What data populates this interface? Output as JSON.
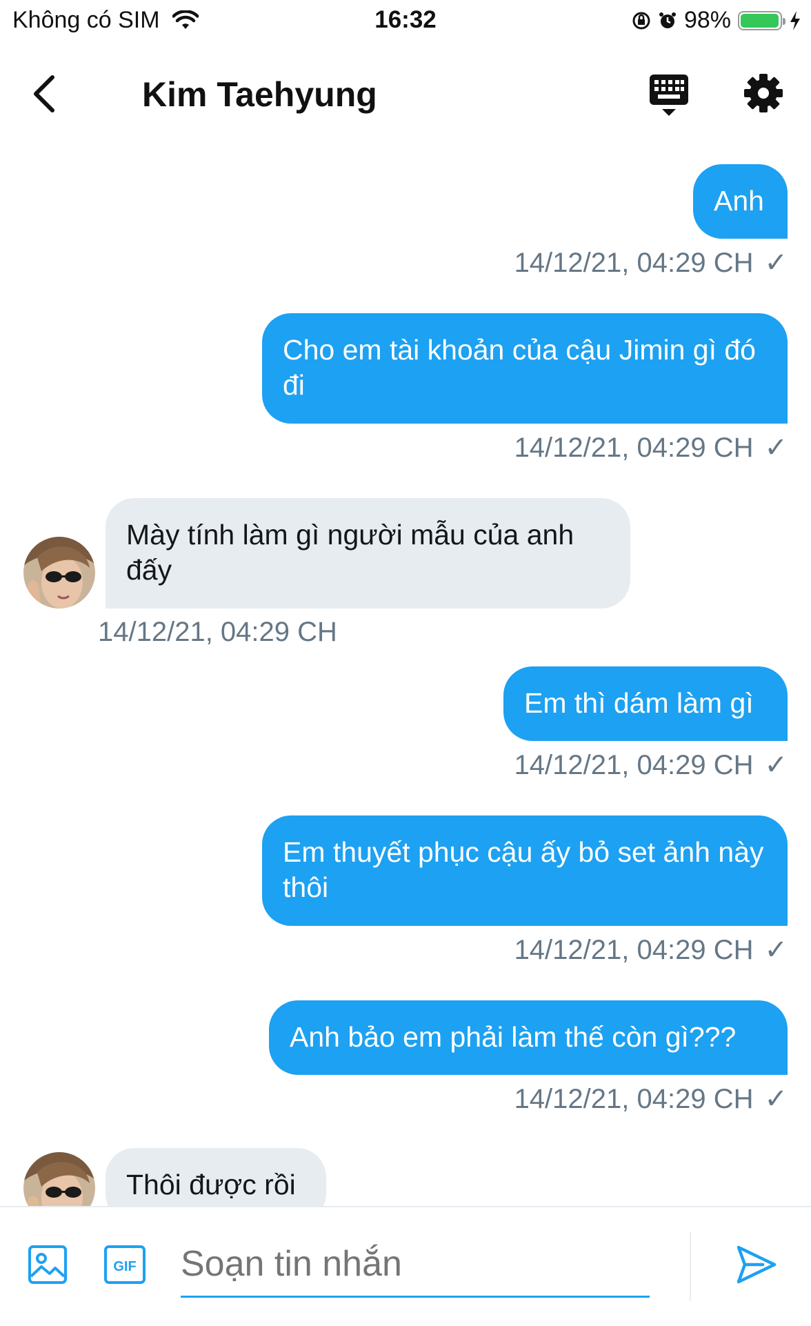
{
  "status_bar": {
    "carrier": "Không có SIM",
    "time": "16:32",
    "battery": "98%",
    "battery_level": 0.98
  },
  "header": {
    "title": "Kim Taehyung"
  },
  "messages": [
    {
      "direction": "out",
      "text": "Anh",
      "time": "14/12/21, 04:29 CH",
      "check": "✓"
    },
    {
      "direction": "out",
      "text": "Cho em tài khoản của cậu Jimin gì đó đi",
      "time": "14/12/21, 04:29 CH",
      "check": "✓"
    },
    {
      "direction": "in",
      "text": "Mày tính làm gì người mẫu của anh đấy",
      "time": "14/12/21, 04:29 CH"
    },
    {
      "direction": "out",
      "text": "Em thì dám làm gì",
      "time": "14/12/21, 04:29 CH",
      "check": "✓"
    },
    {
      "direction": "out",
      "text": "Em thuyết phục cậu ấy bỏ set ảnh này thôi",
      "time": "14/12/21, 04:29 CH",
      "check": "✓"
    },
    {
      "direction": "out",
      "text": "Anh bảo em phải làm thế còn gì???",
      "time": "14/12/21, 04:29 CH",
      "check": "✓"
    },
    {
      "direction": "in",
      "text": "Thôi được rồi"
    }
  ],
  "composer": {
    "placeholder": "Soạn tin nhắn",
    "gif_label": "GIF"
  },
  "colors": {
    "accent": "#1da1f2",
    "incoming_bubble": "#e7ecf0",
    "meta_text": "#657786"
  }
}
